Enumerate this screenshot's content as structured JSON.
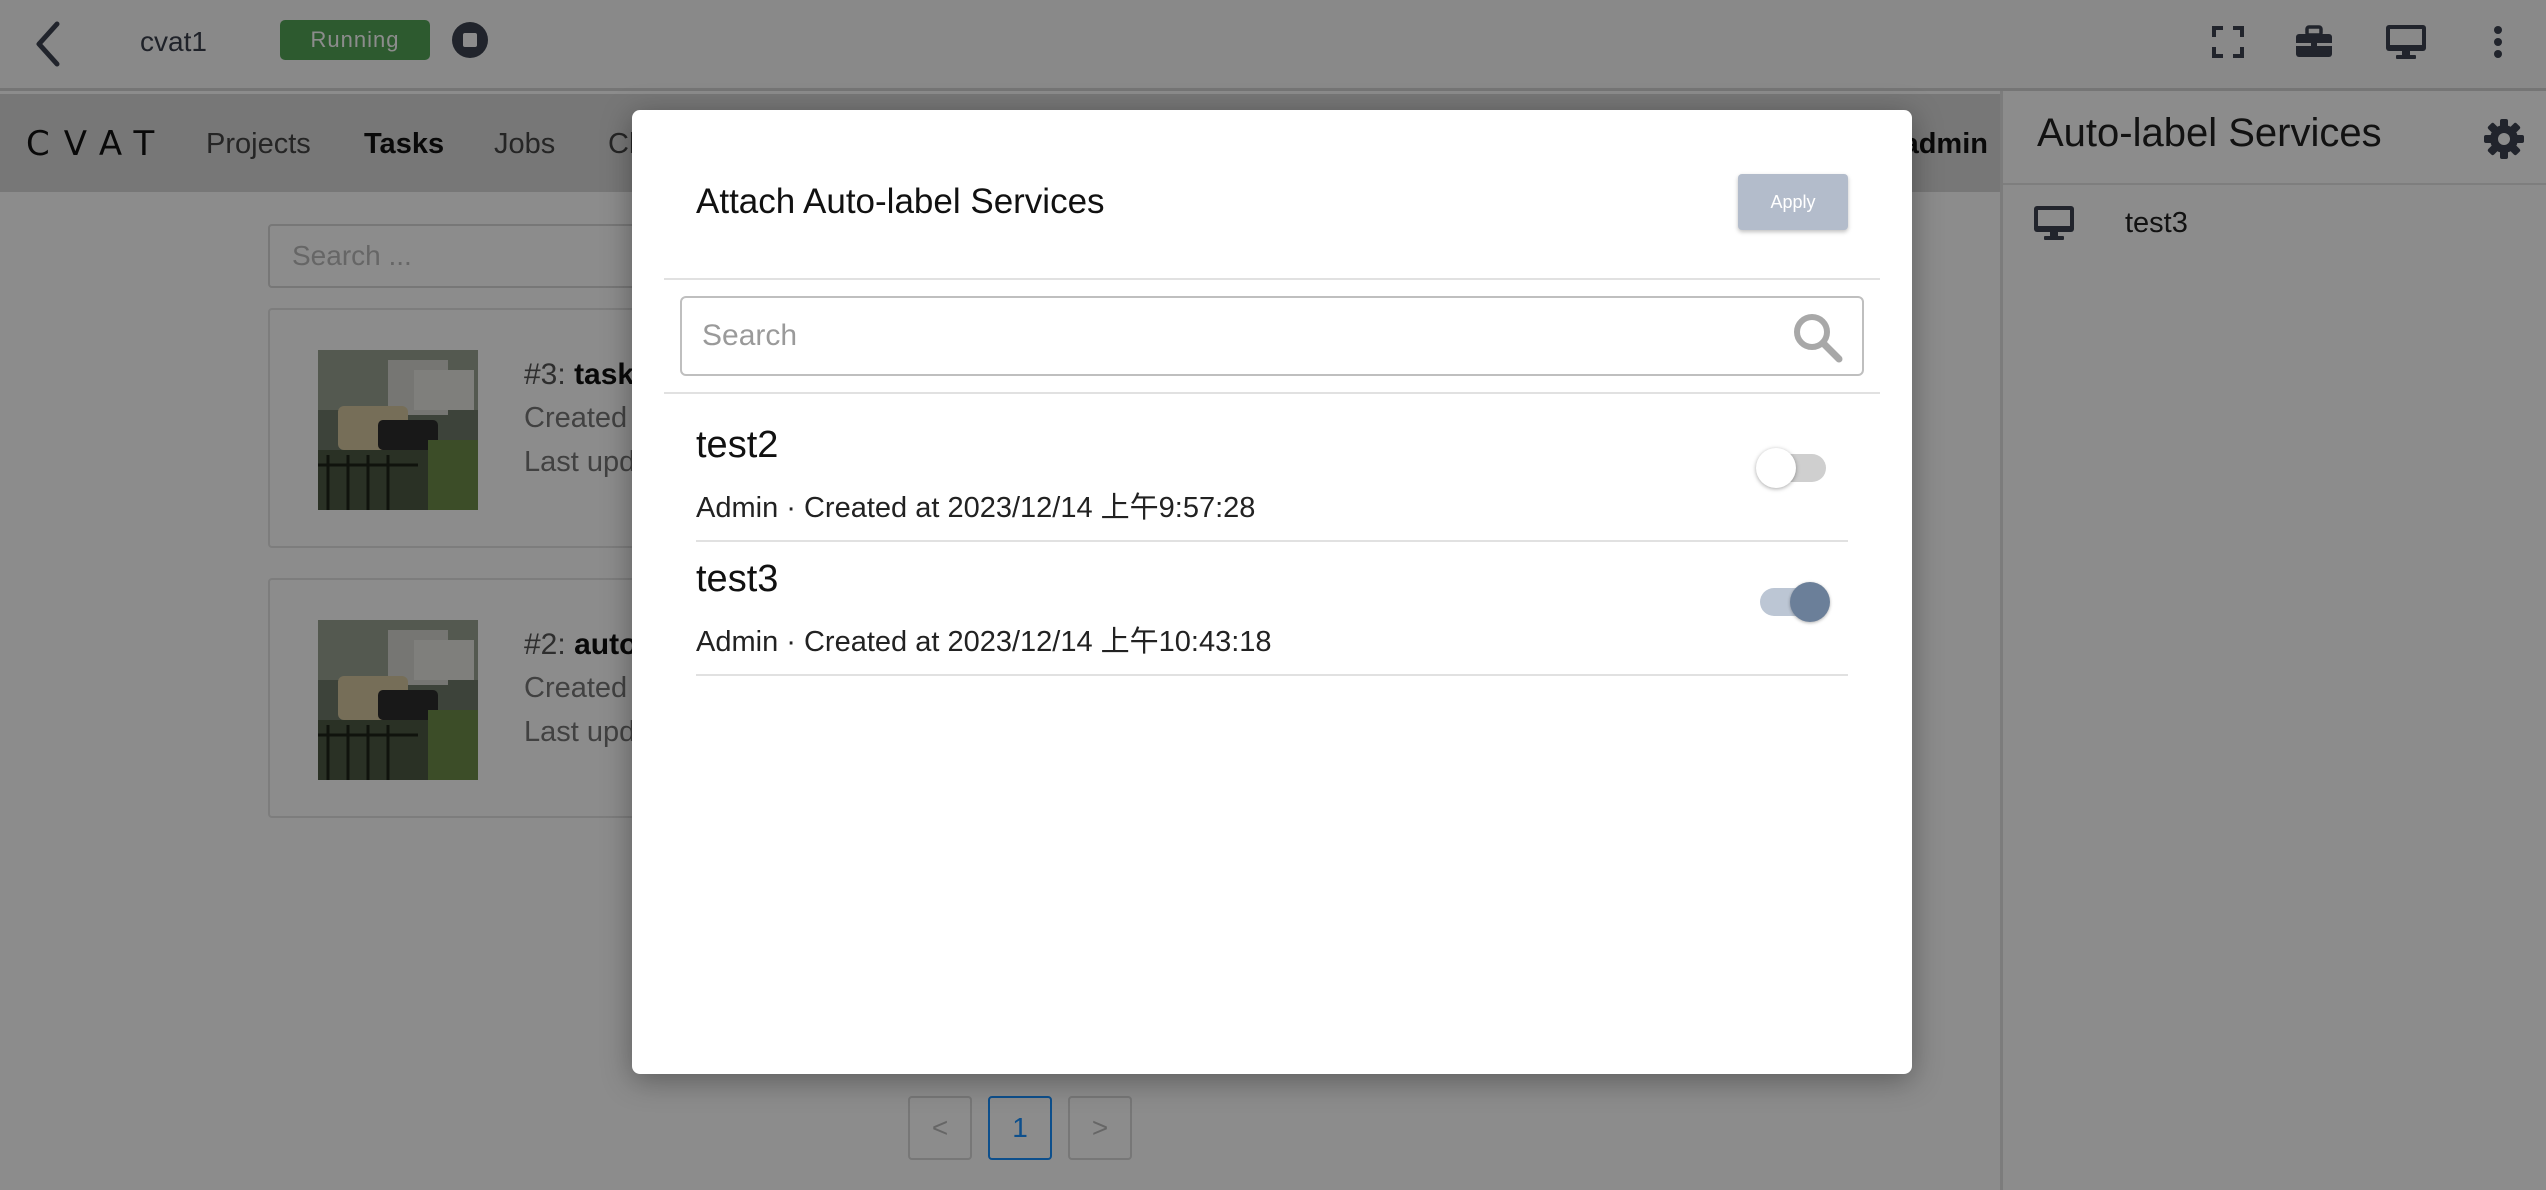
{
  "window": {
    "vm_name": "cvat1",
    "status": "Running",
    "status_color": "#52a556"
  },
  "cvat": {
    "logo": "CVAT",
    "nav": [
      "Projects",
      "Tasks",
      "Jobs",
      "Cl"
    ],
    "active_nav": "Tasks",
    "user": "admin",
    "search_placeholder": "Search ...",
    "tasks": [
      {
        "id": "#3:",
        "name": "task",
        "line1": "Created",
        "line2": "Last upd"
      },
      {
        "id": "#2:",
        "name": "auto",
        "line1": "Created",
        "line2": "Last upd"
      }
    ],
    "pagination": {
      "prev": "<",
      "current": "1",
      "next": ">"
    }
  },
  "side_panel": {
    "title": "Auto-label Services",
    "items": [
      {
        "label": "test3",
        "icon": "monitor-icon"
      }
    ]
  },
  "modal": {
    "title": "Attach Auto-label Services",
    "apply_label": "Apply",
    "search_placeholder": "Search",
    "services": [
      {
        "name": "test2",
        "meta": "Admin · Created at 2023/12/14 上午9:57:28",
        "enabled": false
      },
      {
        "name": "test3",
        "meta": "Admin · Created at 2023/12/14 上午10:43:18",
        "enabled": true
      }
    ]
  },
  "colors": {
    "toggle_on_knob": "#6b7f99",
    "apply_button": "#b3bccb",
    "pagination_active": "#1890ff"
  }
}
